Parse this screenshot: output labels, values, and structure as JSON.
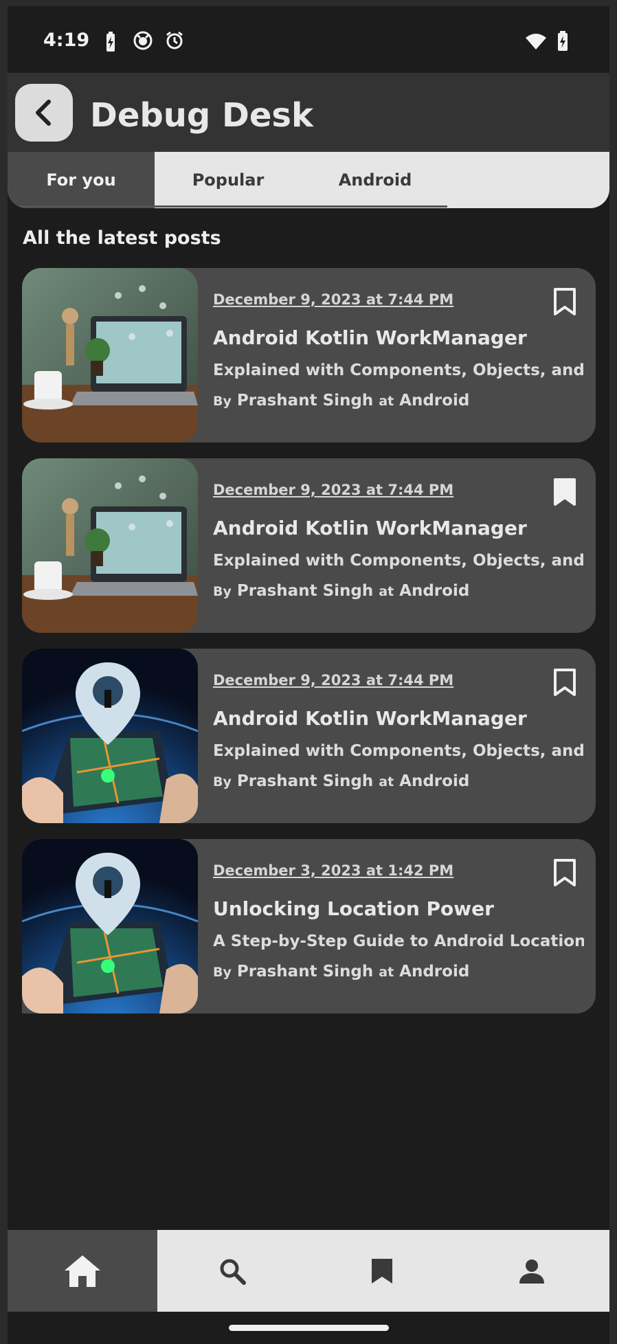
{
  "status_bar": {
    "time": "4:19",
    "icons": [
      "battery-charging-icon",
      "github-icon",
      "alarm-icon",
      "wifi-icon",
      "battery-icon"
    ]
  },
  "app_bar": {
    "title": "Debug Desk",
    "back_icon": "chevron-left-icon"
  },
  "tabs": [
    {
      "label": "For you",
      "active": true
    },
    {
      "label": "Popular",
      "active": false
    },
    {
      "label": "Android",
      "active": false
    }
  ],
  "section_heading": "All the latest posts",
  "posts": [
    {
      "date": "December 9, 2023 at 7:44 PM",
      "title": "Android Kotlin WorkManager",
      "subtitle": "Explained with Components, Objects, and",
      "by": "By",
      "author": "Prashant Singh",
      "at": "at",
      "category": "Android",
      "bookmarked": false,
      "thumbnail": "laptop-desk-image"
    },
    {
      "date": "December 9, 2023 at 7:44 PM",
      "title": "Android Kotlin WorkManager",
      "subtitle": "Explained with Components, Objects, and",
      "by": "By",
      "author": "Prashant Singh",
      "at": "at",
      "category": "Android",
      "bookmarked": true,
      "thumbnail": "laptop-desk-image"
    },
    {
      "date": "December 9, 2023 at 7:44 PM",
      "title": "Android Kotlin WorkManager",
      "subtitle": "Explained with Components, Objects, and",
      "by": "By",
      "author": "Prashant Singh",
      "at": "at",
      "category": "Android",
      "bookmarked": false,
      "thumbnail": "location-phone-image"
    },
    {
      "date": "December 3, 2023 at 1:42 PM",
      "title": "Unlocking Location Power",
      "subtitle": "A Step-by-Step Guide to Android Location",
      "by": "By",
      "author": "Prashant Singh",
      "at": "at",
      "category": "Android",
      "bookmarked": false,
      "thumbnail": "location-phone-image"
    }
  ],
  "bottom_nav": [
    {
      "icon": "home-icon",
      "active": true
    },
    {
      "icon": "search-icon",
      "active": false
    },
    {
      "icon": "bookmark-icon",
      "active": false
    },
    {
      "icon": "person-icon",
      "active": false
    }
  ],
  "colors": {
    "background": "#1c1c1c",
    "card": "#4a4a4a",
    "appbar": "#333333",
    "tab_bar": "#e6e6e6",
    "active_tab": "#4a4a4a"
  }
}
